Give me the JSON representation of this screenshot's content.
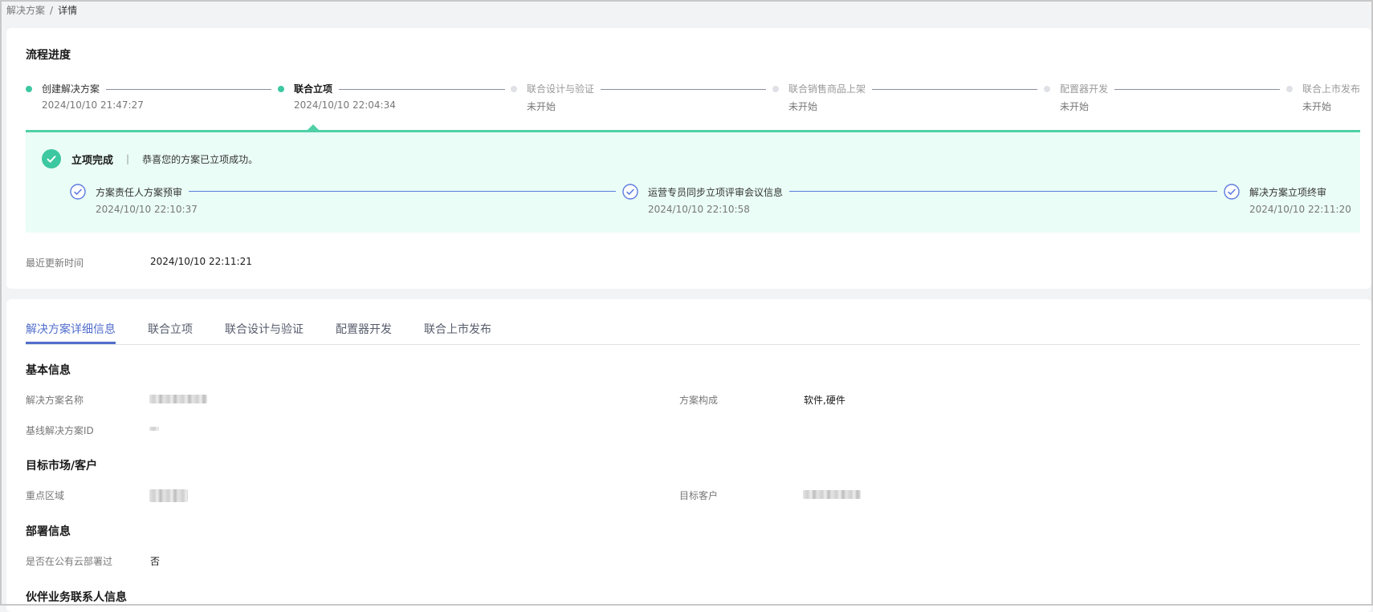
{
  "breadcrumb": {
    "parent": "解决方案",
    "separator": "/",
    "current": "详情"
  },
  "progress": {
    "title": "流程进度",
    "steps": [
      {
        "label": "创建解决方案",
        "time": "2024/10/10 21:47:27",
        "status": "done"
      },
      {
        "label": "联合立项",
        "time": "2024/10/10 22:04:34",
        "status": "current"
      },
      {
        "label": "联合设计与验证",
        "time": "未开始",
        "status": "pending"
      },
      {
        "label": "联合销售商品上架",
        "time": "未开始",
        "status": "pending"
      },
      {
        "label": "配置器开发",
        "time": "未开始",
        "status": "pending"
      },
      {
        "label": "联合上市发布",
        "time": "未开始",
        "status": "pending"
      }
    ]
  },
  "panel": {
    "title": "立项完成",
    "separator": "|",
    "message": "恭喜您的方案已立项成功。",
    "substeps": [
      {
        "label": "方案责任人方案预审",
        "time": "2024/10/10 22:10:37"
      },
      {
        "label": "运营专员同步立项评审会议信息",
        "time": "2024/10/10 22:10:58"
      },
      {
        "label": "解决方案立项终审",
        "time": "2024/10/10 22:11:20"
      }
    ]
  },
  "last_update": {
    "label": "最近更新时间",
    "value": "2024/10/10 22:11:21"
  },
  "tabs": [
    {
      "label": "解决方案详细信息",
      "active": true
    },
    {
      "label": "联合立项",
      "active": false
    },
    {
      "label": "联合设计与验证",
      "active": false
    },
    {
      "label": "配置器开发",
      "active": false
    },
    {
      "label": "联合上市发布",
      "active": false
    }
  ],
  "details": {
    "basic": {
      "title": "基本信息",
      "name_label": "解决方案名称",
      "composition_label": "方案构成",
      "composition_value": "软件,硬件",
      "baseline_label": "基线解决方案ID"
    },
    "market": {
      "title": "目标市场/客户",
      "region_label": "重点区域",
      "customer_label": "目标客户"
    },
    "deploy": {
      "title": "部署信息",
      "public_cloud_label": "是否在公有云部署过",
      "public_cloud_value": "否"
    },
    "contact": {
      "title": "伙伴业务联系人信息"
    }
  },
  "colors": {
    "accent": "#526ecc",
    "success": "#3cc8a0",
    "panel_bg": "#eafdf6"
  }
}
